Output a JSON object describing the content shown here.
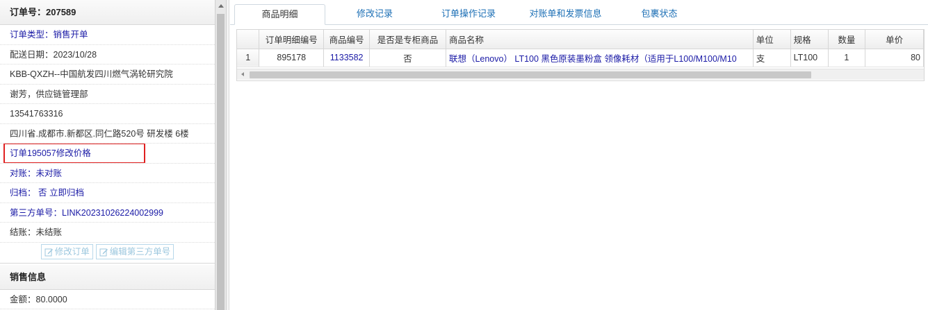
{
  "order": {
    "header": "订单号：207589",
    "type_label": "订单类型：",
    "type_value": "销售开单",
    "delivery_date": "配送日期：2023/10/28",
    "customer": "KBB-QXZH--中国航发四川燃气涡轮研究院",
    "contact": "谢芳，供应链管理部",
    "phone": "13541763316",
    "address": "四川省.成都市.新都区.同仁路520号 研发楼 6楼",
    "note_link": "订单195057修改价格",
    "reconcile_label": "对账：",
    "reconcile_value": "未对账",
    "archive_label": "归档：",
    "archive_value": "否",
    "archive_action": "立即归档",
    "third_party_label": "第三方单号：",
    "third_party_value": "LINK20231026224002999",
    "settle": "结账：未结账",
    "edit_order_btn": "修改订单",
    "edit_third_btn": "编辑第三方单号"
  },
  "sales": {
    "title": "销售信息",
    "amount": "金额：80.0000"
  },
  "tabs": [
    {
      "label": "商品明细"
    },
    {
      "label": "修改记录"
    },
    {
      "label": "订单操作记录"
    },
    {
      "label": "对账单和发票信息"
    },
    {
      "label": "包裹状态"
    }
  ],
  "grid": {
    "columns": [
      "订单明细编号",
      "商品编号",
      "是否是专柜商品",
      "商品名称",
      "单位",
      "规格",
      "数量",
      "单价"
    ],
    "rows": [
      {
        "num": "1",
        "detail_id": "895178",
        "product_id": "1133582",
        "is_counter": "否",
        "name": "联想（Lenovo） LT100 黑色原装墨粉盒 领像耗材（适用于L100/M100/M10",
        "unit": "支",
        "spec": "LT100",
        "qty": "1",
        "price": "80"
      }
    ]
  },
  "colors": {
    "link": "#1a1aa6",
    "tab_link": "#1c6fb5",
    "highlight_border": "#e02020"
  }
}
